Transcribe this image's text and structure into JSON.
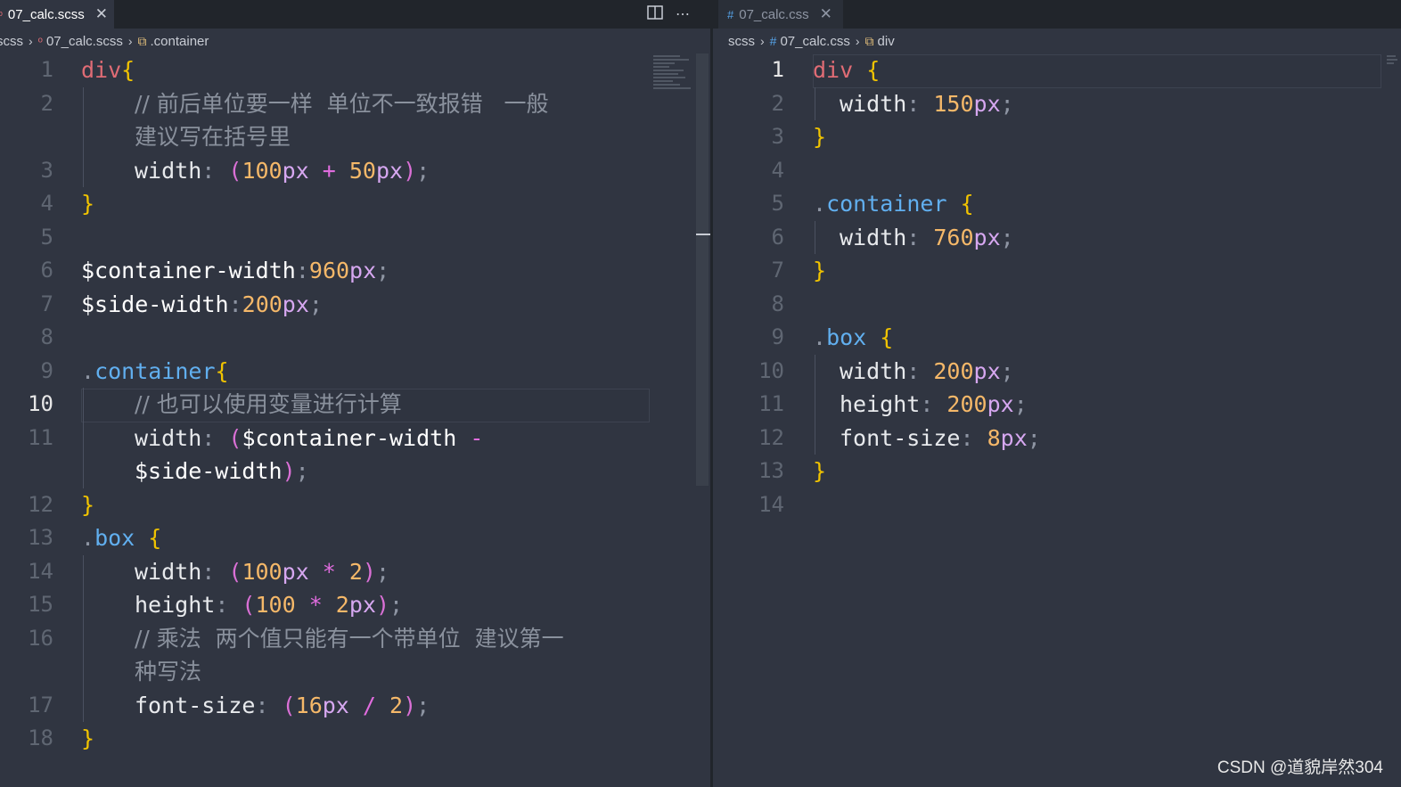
{
  "left": {
    "tab": {
      "title": "07_calc.scss",
      "close": "✕",
      "icon": "scss-file-icon"
    },
    "actions": {
      "split": "split-editor-icon",
      "more": "⋯"
    },
    "breadcrumb": {
      "folder": "scss",
      "file": "07_calc.scss",
      "symbol": ".container"
    },
    "current_line": "10"
  },
  "right": {
    "tab": {
      "title": "07_calc.css",
      "close": "✕",
      "icon": "css-file-icon"
    },
    "breadcrumb": {
      "folder": "scss",
      "file": "07_calc.css",
      "symbol": "div"
    },
    "current_line": "1"
  },
  "left_code": [
    {
      "n": "1",
      "segs": [
        [
          "div",
          "sel"
        ],
        [
          "{",
          "brace"
        ]
      ]
    },
    {
      "n": "2",
      "indent": 1,
      "segs": [
        [
          "// 前后单位要一样  单位不一致报错   一般",
          "comment"
        ]
      ]
    },
    {
      "n": "",
      "indent": 1,
      "segs": [
        [
          "建议写在括号里",
          "comment"
        ]
      ]
    },
    {
      "n": "3",
      "indent": 1,
      "segs": [
        [
          "width",
          "prop"
        ],
        [
          ": ",
          "punc"
        ],
        [
          "(",
          "paren"
        ],
        [
          "100",
          "num"
        ],
        [
          "px",
          "unit"
        ],
        [
          " + ",
          "op"
        ],
        [
          "50",
          "num"
        ],
        [
          "px",
          "unit"
        ],
        [
          ")",
          "paren"
        ],
        [
          ";",
          "punc"
        ]
      ]
    },
    {
      "n": "4",
      "segs": [
        [
          "}",
          "brace"
        ]
      ]
    },
    {
      "n": "5",
      "segs": []
    },
    {
      "n": "6",
      "segs": [
        [
          "$container-width",
          "var"
        ],
        [
          ":",
          "punc"
        ],
        [
          "960",
          "num"
        ],
        [
          "px",
          "unit"
        ],
        [
          ";",
          "punc"
        ]
      ]
    },
    {
      "n": "7",
      "segs": [
        [
          "$side-width",
          "var"
        ],
        [
          ":",
          "punc"
        ],
        [
          "200",
          "num"
        ],
        [
          "px",
          "unit"
        ],
        [
          ";",
          "punc"
        ]
      ]
    },
    {
      "n": "8",
      "segs": []
    },
    {
      "n": "9",
      "segs": [
        [
          ".",
          "punc"
        ],
        [
          "container",
          "cls"
        ],
        [
          "{",
          "brace"
        ]
      ]
    },
    {
      "n": "10",
      "indent": 1,
      "segs": [
        [
          "// 也可以使用变量进行计算",
          "comment"
        ]
      ]
    },
    {
      "n": "11",
      "indent": 1,
      "segs": [
        [
          "width",
          "prop"
        ],
        [
          ": ",
          "punc"
        ],
        [
          "(",
          "paren"
        ],
        [
          "$container-width",
          "var"
        ],
        [
          " -",
          "op"
        ]
      ]
    },
    {
      "n": "",
      "indent": 1,
      "segs": [
        [
          "$side-width",
          "var"
        ],
        [
          ")",
          "paren"
        ],
        [
          ";",
          "punc"
        ]
      ]
    },
    {
      "n": "12",
      "segs": [
        [
          "}",
          "brace"
        ]
      ]
    },
    {
      "n": "13",
      "segs": [
        [
          ".",
          "punc"
        ],
        [
          "box",
          "cls"
        ],
        [
          " ",
          "punc"
        ],
        [
          "{",
          "brace"
        ]
      ]
    },
    {
      "n": "14",
      "indent": 1,
      "segs": [
        [
          "width",
          "prop"
        ],
        [
          ": ",
          "punc"
        ],
        [
          "(",
          "paren"
        ],
        [
          "100",
          "num"
        ],
        [
          "px",
          "unit"
        ],
        [
          " * ",
          "op"
        ],
        [
          "2",
          "num"
        ],
        [
          ")",
          "paren"
        ],
        [
          ";",
          "punc"
        ]
      ]
    },
    {
      "n": "15",
      "indent": 1,
      "segs": [
        [
          "height",
          "prop"
        ],
        [
          ": ",
          "punc"
        ],
        [
          "(",
          "paren"
        ],
        [
          "100",
          "num"
        ],
        [
          " * ",
          "op"
        ],
        [
          "2",
          "num"
        ],
        [
          "px",
          "unit"
        ],
        [
          ")",
          "paren"
        ],
        [
          ";",
          "punc"
        ]
      ]
    },
    {
      "n": "16",
      "indent": 1,
      "segs": [
        [
          "// 乘法  两个值只能有一个带单位  建议第一",
          "comment"
        ]
      ]
    },
    {
      "n": "",
      "indent": 1,
      "segs": [
        [
          "种写法",
          "comment"
        ]
      ]
    },
    {
      "n": "17",
      "indent": 1,
      "segs": [
        [
          "font-size",
          "prop"
        ],
        [
          ": ",
          "punc"
        ],
        [
          "(",
          "paren"
        ],
        [
          "16",
          "num"
        ],
        [
          "px",
          "unit"
        ],
        [
          " / ",
          "op"
        ],
        [
          "2",
          "num"
        ],
        [
          ")",
          "paren"
        ],
        [
          ";",
          "punc"
        ]
      ]
    },
    {
      "n": "18",
      "segs": [
        [
          "}",
          "brace"
        ]
      ]
    }
  ],
  "right_code": [
    {
      "n": "1",
      "segs": [
        [
          "div",
          "sel"
        ],
        [
          " ",
          "punc"
        ],
        [
          "{",
          "brace"
        ]
      ]
    },
    {
      "n": "2",
      "indent": 1,
      "segs": [
        [
          "width",
          "prop"
        ],
        [
          ": ",
          "punc"
        ],
        [
          "150",
          "num"
        ],
        [
          "px",
          "unit"
        ],
        [
          ";",
          "punc"
        ]
      ]
    },
    {
      "n": "3",
      "segs": [
        [
          "}",
          "brace"
        ]
      ]
    },
    {
      "n": "4",
      "segs": []
    },
    {
      "n": "5",
      "segs": [
        [
          ".",
          "punc"
        ],
        [
          "container",
          "cls"
        ],
        [
          " ",
          "punc"
        ],
        [
          "{",
          "brace"
        ]
      ]
    },
    {
      "n": "6",
      "indent": 1,
      "segs": [
        [
          "width",
          "prop"
        ],
        [
          ": ",
          "punc"
        ],
        [
          "760",
          "num"
        ],
        [
          "px",
          "unit"
        ],
        [
          ";",
          "punc"
        ]
      ]
    },
    {
      "n": "7",
      "segs": [
        [
          "}",
          "brace"
        ]
      ]
    },
    {
      "n": "8",
      "segs": []
    },
    {
      "n": "9",
      "segs": [
        [
          ".",
          "punc"
        ],
        [
          "box",
          "cls"
        ],
        [
          " ",
          "punc"
        ],
        [
          "{",
          "brace"
        ]
      ]
    },
    {
      "n": "10",
      "indent": 1,
      "segs": [
        [
          "width",
          "prop"
        ],
        [
          ": ",
          "punc"
        ],
        [
          "200",
          "num"
        ],
        [
          "px",
          "unit"
        ],
        [
          ";",
          "punc"
        ]
      ]
    },
    {
      "n": "11",
      "indent": 1,
      "segs": [
        [
          "height",
          "prop"
        ],
        [
          ": ",
          "punc"
        ],
        [
          "200",
          "num"
        ],
        [
          "px",
          "unit"
        ],
        [
          ";",
          "punc"
        ]
      ]
    },
    {
      "n": "12",
      "indent": 1,
      "segs": [
        [
          "font-size",
          "prop"
        ],
        [
          ": ",
          "punc"
        ],
        [
          "8",
          "num"
        ],
        [
          "px",
          "unit"
        ],
        [
          ";",
          "punc"
        ]
      ]
    },
    {
      "n": "13",
      "segs": [
        [
          "}",
          "brace"
        ]
      ]
    },
    {
      "n": "14",
      "segs": []
    }
  ],
  "watermark": "CSDN @道貌岸然304",
  "colors": {
    "background": "#303541",
    "selector": "#e06c75",
    "brace": "#f0c300",
    "number": "#f5b869",
    "unit": "#d6a7f0",
    "operator": "#e06cde",
    "comment": "#8a919d"
  }
}
